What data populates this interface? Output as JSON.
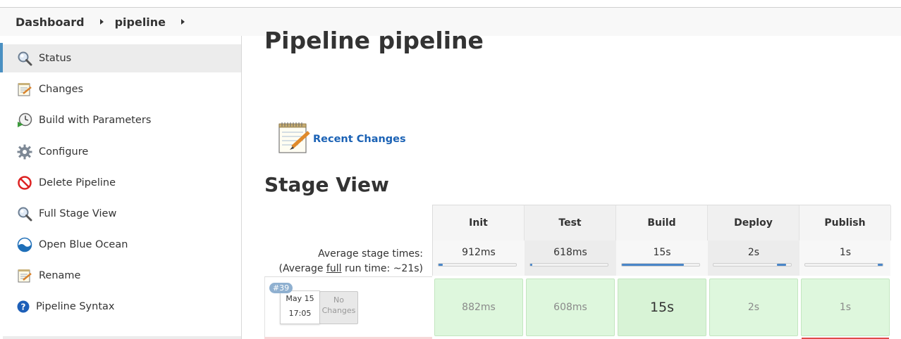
{
  "breadcrumb": {
    "items": [
      {
        "label": "Dashboard"
      },
      {
        "label": "pipeline"
      }
    ]
  },
  "sidebar": {
    "items": [
      {
        "label": "Status",
        "icon": "magnifier-icon",
        "active": true
      },
      {
        "label": "Changes",
        "icon": "notepad-icon"
      },
      {
        "label": "Build with Parameters",
        "icon": "clock-play-icon"
      },
      {
        "label": "Configure",
        "icon": "gear-icon"
      },
      {
        "label": "Delete Pipeline",
        "icon": "no-entry-icon"
      },
      {
        "label": "Full Stage View",
        "icon": "magnifier-icon"
      },
      {
        "label": "Open Blue Ocean",
        "icon": "blue-ocean-icon"
      },
      {
        "label": "Rename",
        "icon": "notepad-icon"
      },
      {
        "label": "Pipeline Syntax",
        "icon": "help-icon"
      }
    ]
  },
  "main": {
    "title": "Pipeline pipeline",
    "recent_changes": "Recent Changes",
    "stage_view_title": "Stage View"
  },
  "stage_view": {
    "stages": [
      "Init",
      "Test",
      "Build",
      "Deploy",
      "Publish"
    ],
    "average_label": "Average stage times:",
    "average_full_prefix": "(Average ",
    "average_full_word": "full",
    "average_full_suffix": " run time: ~21s)",
    "averages": [
      {
        "value": "912ms",
        "fill_start": 0.0,
        "fill_fraction": 0.05
      },
      {
        "value": "618ms",
        "fill_start": 0.0,
        "fill_fraction": 0.03
      },
      {
        "value": "15s",
        "fill_start": 0.0,
        "fill_fraction": 0.8
      },
      {
        "value": "2s",
        "fill_start": 0.82,
        "fill_fraction": 0.12
      },
      {
        "value": "1s",
        "fill_start": 0.94,
        "fill_fraction": 0.06
      }
    ],
    "runs": [
      {
        "badge": "#39",
        "date": "May 15",
        "time": "17:05",
        "changes_line1": "No",
        "changes_line2": "Changes",
        "cells": [
          "882ms",
          "608ms",
          "15s",
          "2s",
          "1s"
        ]
      }
    ]
  },
  "colors": {
    "link": "#1b62b5",
    "success_cell": "#def7dd",
    "progress": "#4a86c8",
    "active_bar": "#4a90c2"
  }
}
